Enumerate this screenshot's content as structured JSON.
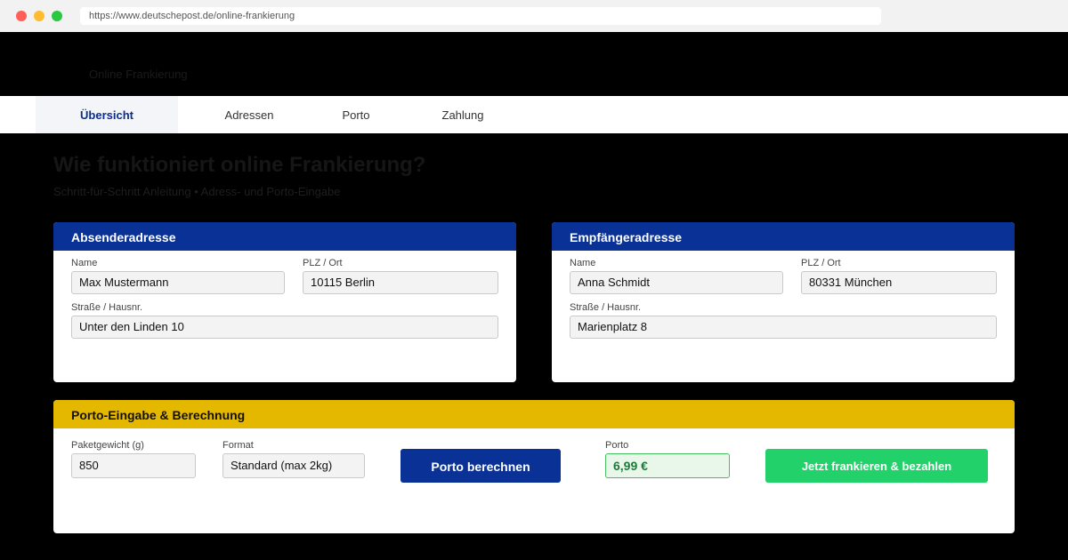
{
  "browser": {
    "url": "https://www.deutschepost.de/online-frankierung"
  },
  "header": {
    "title": "Online Frankierung"
  },
  "tabs": [
    {
      "label": "Übersicht",
      "active": true
    },
    {
      "label": "Adressen",
      "active": false
    },
    {
      "label": "Porto",
      "active": false
    },
    {
      "label": "Zahlung",
      "active": false
    }
  ],
  "intro": {
    "title": "Wie funktioniert online Frankierung?",
    "subtitle": "Schritt-für-Schritt Anleitung • Adress- und Porto-Eingabe"
  },
  "sender": {
    "title": "Absenderadresse",
    "name_label": "Name",
    "name_value": "Max Mustermann",
    "plz_label": "PLZ / Ort",
    "plz_value": "10115 Berlin",
    "street_label": "Straße / Hausnr.",
    "street_value": "Unter den Linden 10"
  },
  "recipient": {
    "title": "Empfängeradresse",
    "name_label": "Name",
    "name_value": "Anna Schmidt",
    "plz_label": "PLZ / Ort",
    "plz_value": "80331 München",
    "street_label": "Straße / Hausnr.",
    "street_value": "Marienplatz 8"
  },
  "porto": {
    "title": "Porto-Eingabe & Berechnung",
    "weight_label": "Paketgewicht (g)",
    "weight_value": "850",
    "format_label": "Format",
    "format_value": "Standard (max 2kg)",
    "calc_button": "Porto berechnen",
    "result_label": "Porto",
    "result_value": "6,99 €",
    "pay_button": "Jetzt frankieren & bezahlen"
  },
  "colors": {
    "brand_blue": "#0a3296",
    "brand_yellow": "#e5b800",
    "pay_green": "#22d16a",
    "result_green": "#1e7a3a"
  }
}
